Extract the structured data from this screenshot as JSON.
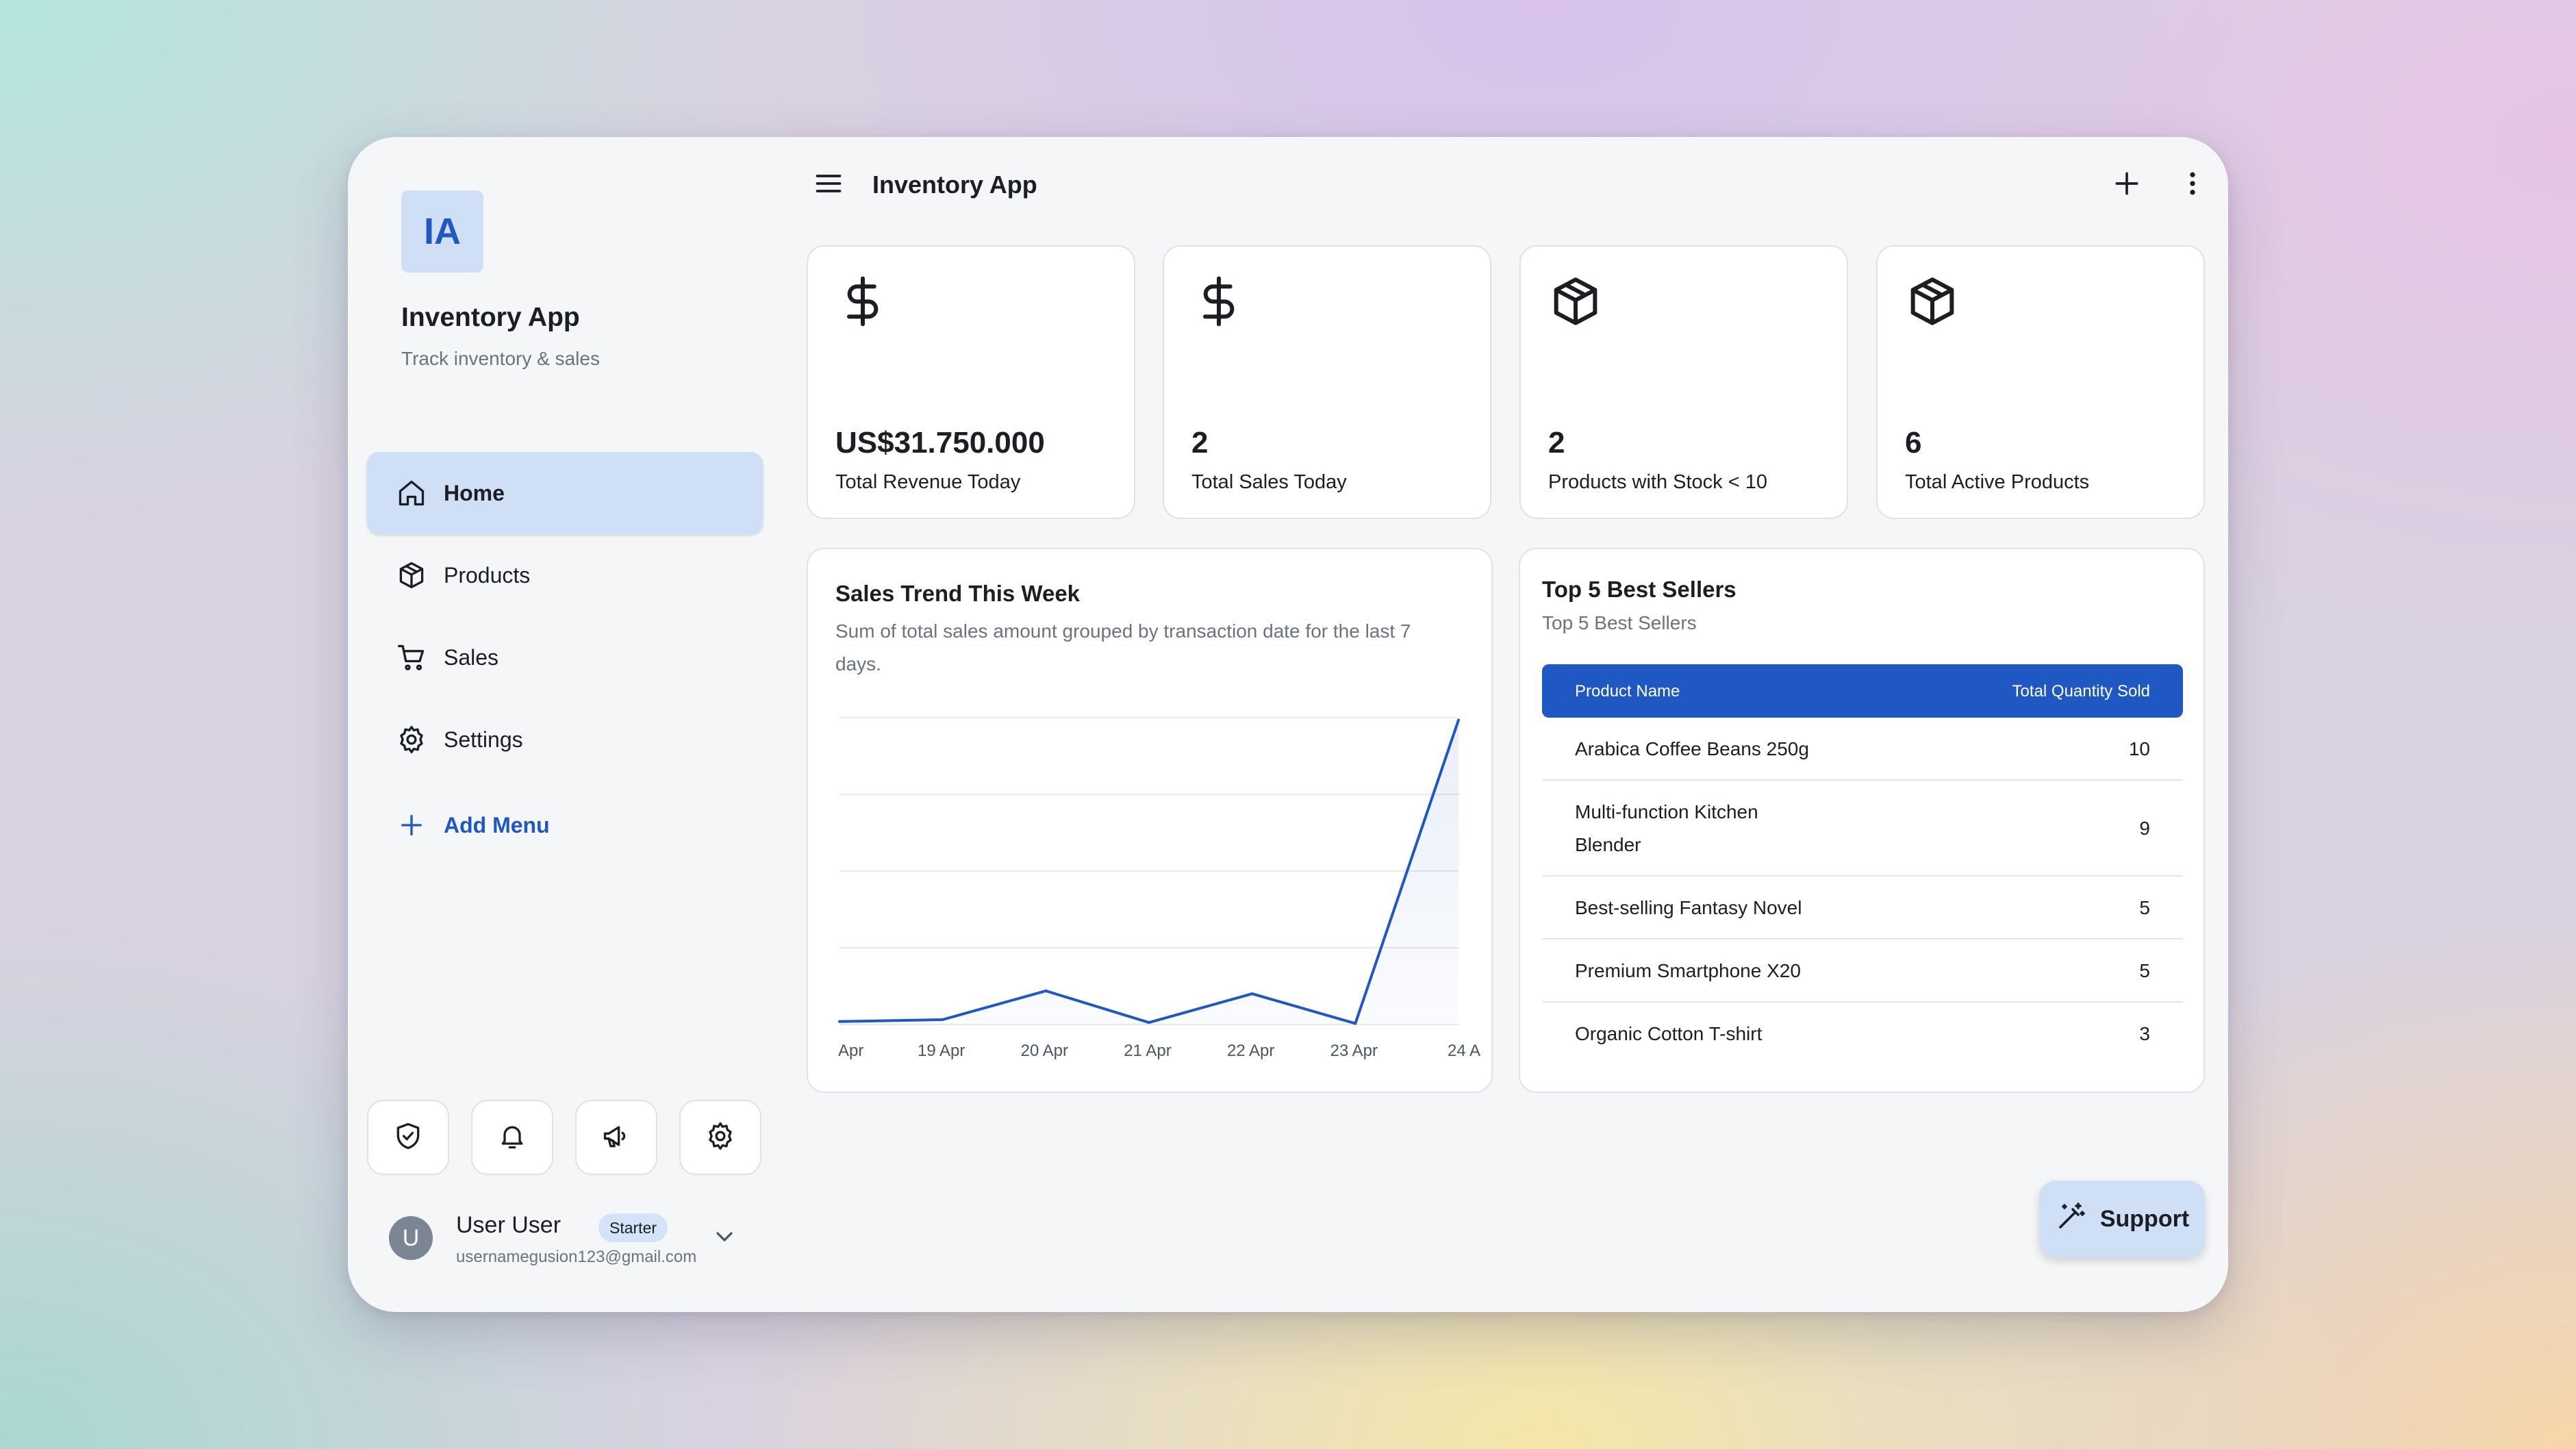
{
  "app": {
    "logo_initials": "IA",
    "name": "Inventory App",
    "tagline": "Track inventory & sales"
  },
  "nav": {
    "items": [
      {
        "label": "Home",
        "icon": "home-icon",
        "active": true
      },
      {
        "label": "Products",
        "icon": "box-icon",
        "active": false
      },
      {
        "label": "Sales",
        "icon": "cart-icon",
        "active": false
      },
      {
        "label": "Settings",
        "icon": "gear-icon",
        "active": false
      }
    ],
    "add_menu_label": "Add Menu"
  },
  "quick_actions": [
    "shield-check-icon",
    "bell-icon",
    "megaphone-icon",
    "gear-icon"
  ],
  "user": {
    "avatar_letter": "U",
    "name": "User User",
    "plan": "Starter",
    "email": "usernamegusion123@gmail.com"
  },
  "topbar": {
    "title": "Inventory App"
  },
  "stats": [
    {
      "icon": "dollar-icon",
      "value": "US$31.750.000",
      "label": "Total Revenue Today"
    },
    {
      "icon": "dollar-icon",
      "value": "2",
      "label": "Total Sales Today"
    },
    {
      "icon": "box-icon",
      "value": "2",
      "label": "Products with Stock < 10"
    },
    {
      "icon": "box-icon",
      "value": "6",
      "label": "Total Active Products"
    }
  ],
  "sales_trend": {
    "title": "Sales Trend This Week",
    "description": "Sum of total sales amount grouped by transaction date for the last 7 days."
  },
  "chart_data": {
    "type": "area",
    "categories": [
      "Apr",
      "19 Apr",
      "20 Apr",
      "21 Apr",
      "22 Apr",
      "23 Apr",
      "24 A"
    ],
    "values": [
      0.3,
      0.5,
      3.5,
      0.2,
      3.2,
      0.1,
      31.75
    ],
    "ylim": [
      0,
      32
    ],
    "grid": true,
    "color": "#1f57c3"
  },
  "best_sellers": {
    "title": "Top 5 Best Sellers",
    "subtitle": "Top 5 Best Sellers",
    "columns": [
      "Product Name",
      "Total Quantity Sold"
    ],
    "rows": [
      {
        "name": "Arabica Coffee Beans 250g",
        "qty": "10"
      },
      {
        "name": "Multi-function Kitchen Blender",
        "qty": "9"
      },
      {
        "name": "Best-selling Fantasy Novel",
        "qty": "5"
      },
      {
        "name": "Premium Smartphone X20",
        "qty": "5"
      },
      {
        "name": "Organic Cotton T-shirt",
        "qty": "3"
      }
    ]
  },
  "support": {
    "label": "Support",
    "icon": "magic-wand-icon"
  }
}
